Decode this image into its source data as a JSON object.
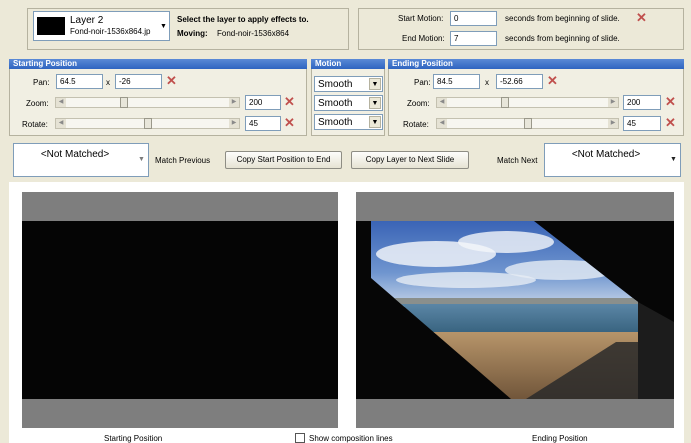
{
  "layer_selector": {
    "name": "Layer  2",
    "file": "Fond-noir-1536x864.jp"
  },
  "layer_info": {
    "instruction": "Select the layer to apply effects to.",
    "moving_label": "Moving:",
    "moving_value": "Fond-noir-1536x864"
  },
  "motion_time": {
    "start_label": "Start Motion:",
    "start_value": "0",
    "end_label": "End Motion:",
    "end_value": "7",
    "seconds_text_1": "seconds from beginning of slide.",
    "seconds_text_2": "seconds from beginning of slide."
  },
  "starting_position": {
    "header": "Starting Position",
    "pan_label": "Pan:",
    "pan_x": "64.5",
    "x_sep": "x",
    "pan_y": "-26",
    "zoom_label": "Zoom:",
    "zoom_value": "200",
    "zoom_level": 0.35,
    "rotate_label": "Rotate:",
    "rotate_value": "45",
    "rotate_level": 0.5
  },
  "motion": {
    "header": "Motion",
    "pan_curve": "Smooth",
    "zoom_curve": "Smooth",
    "rotate_curve": "Smooth"
  },
  "ending_position": {
    "header": "Ending Position",
    "pan_label": "Pan:",
    "pan_x": "84.5",
    "x_sep": "x",
    "pan_y": "-52.66",
    "zoom_label": "Zoom:",
    "zoom_value": "200",
    "zoom_level": 0.35,
    "rotate_label": "Rotate:",
    "rotate_value": "45",
    "rotate_level": 0.5
  },
  "actions": {
    "match_previous_select": "<Not Matched>",
    "match_previous_button": "Match Previous",
    "copy_start_to_end": "Copy Start Position to End",
    "copy_layer_next": "Copy Layer to Next Slide",
    "match_next_button": "Match Next",
    "match_next_select": "<Not Matched>"
  },
  "previews": {
    "start_caption": "Starting Position",
    "composition_lines": "Show composition lines",
    "end_caption": "Ending Position"
  },
  "icons": {
    "remove": "close-x-icon",
    "dropdown": "chevron-down-icon"
  },
  "colors": {
    "header_blue": "#2f64c0",
    "remove_red": "#c0504d",
    "panel_bg": "#ece9d8"
  }
}
